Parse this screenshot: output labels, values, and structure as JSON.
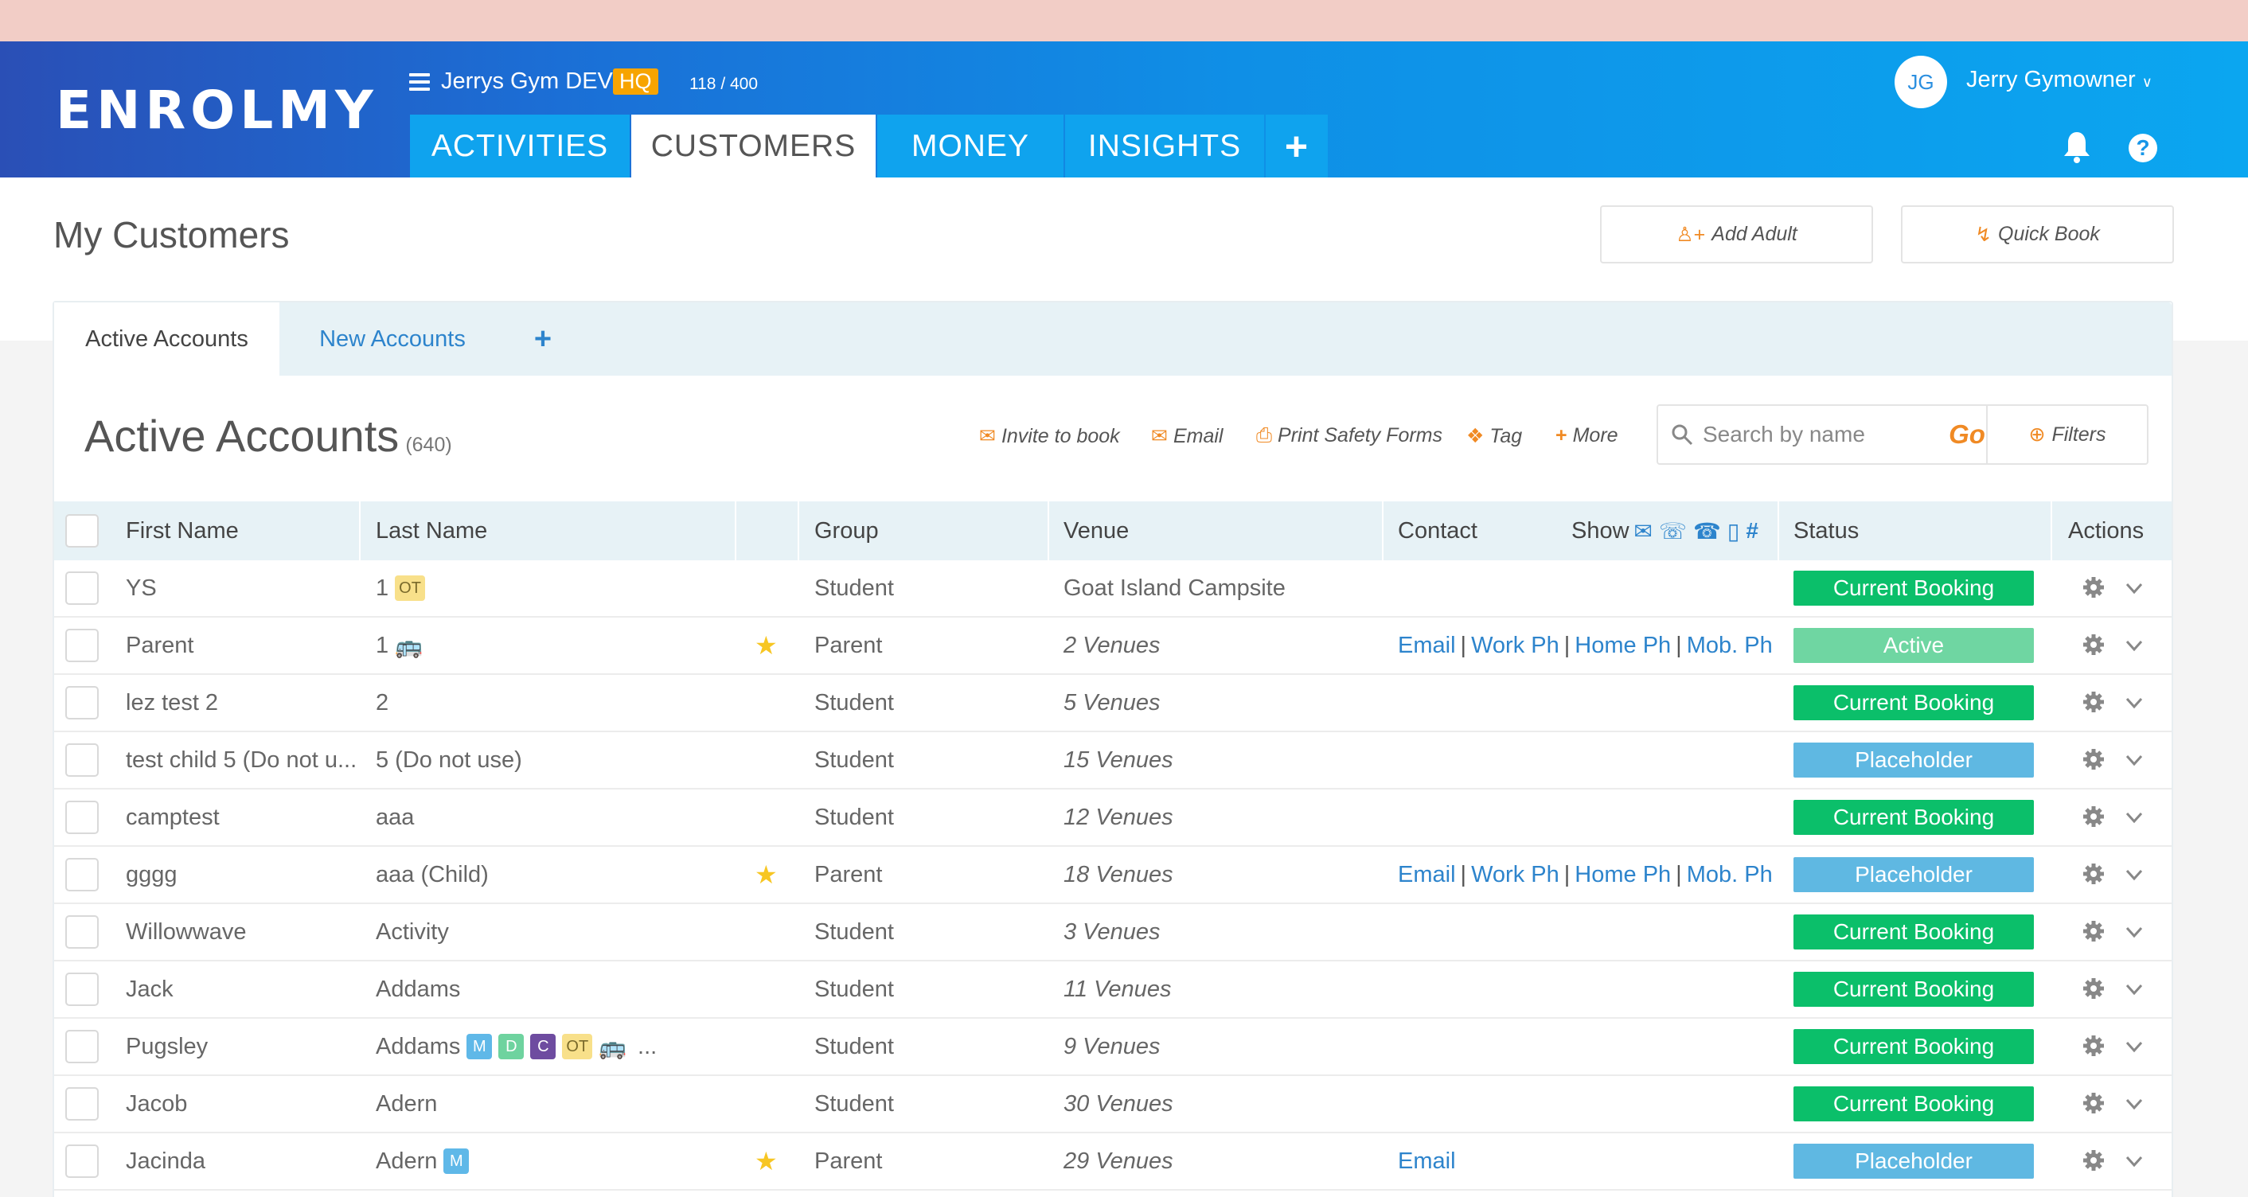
{
  "app": {
    "logo": "ENROLMY",
    "account_name": "Jerrys Gym DEV",
    "hq_badge": "HQ",
    "account_count": "118 / 400",
    "user_initials": "JG",
    "user_name": "Jerry Gymowner",
    "help_label": "?"
  },
  "nav": {
    "tabs": [
      {
        "label": "ACTIVITIES"
      },
      {
        "label": "CUSTOMERS"
      },
      {
        "label": "MONEY"
      },
      {
        "label": "INSIGHTS"
      },
      {
        "label": "+"
      }
    ]
  },
  "page": {
    "title": "My Customers",
    "add_adult_label": "Add Adult",
    "quick_book_label": "Quick Book"
  },
  "subtabs": [
    {
      "label": "Active Accounts"
    },
    {
      "label": "New Accounts"
    },
    {
      "label": "+"
    }
  ],
  "section": {
    "title": "Active Accounts",
    "count": "(640)"
  },
  "toolbar": {
    "invite": "Invite to book",
    "email": "Email",
    "print": "Print Safety Forms",
    "tag": "Tag",
    "more": "More",
    "search_placeholder": "Search by name",
    "go": "Go",
    "filters": "Filters"
  },
  "table": {
    "headers": {
      "first_name": "First Name",
      "last_name": "Last Name",
      "group": "Group",
      "venue": "Venue",
      "contact": "Contact",
      "show": "Show",
      "status": "Status",
      "actions": "Actions"
    },
    "rows": [
      {
        "first": "YS",
        "last": "1",
        "badges": [
          "OT"
        ],
        "bus": false,
        "more": "",
        "star": false,
        "group": "Student",
        "venue": "Goat Island Campsite",
        "venue_italic": false,
        "contact": [],
        "status": "Current Booking",
        "status_color": "#0bbf6a"
      },
      {
        "first": "Parent",
        "last": "1",
        "badges": [],
        "bus": true,
        "more": "",
        "star": true,
        "group": "Parent",
        "venue": "2 Venues",
        "venue_italic": true,
        "contact": [
          "Email",
          "Work Ph",
          "Home Ph",
          "Mob. Ph"
        ],
        "status": "Active",
        "status_color": "#6fd6a2"
      },
      {
        "first": "lez test 2",
        "last": "2",
        "badges": [],
        "bus": false,
        "more": "",
        "star": false,
        "group": "Student",
        "venue": "5 Venues",
        "venue_italic": true,
        "contact": [],
        "status": "Current Booking",
        "status_color": "#0bbf6a"
      },
      {
        "first": "test child 5 (Do not u...",
        "last": "5 (Do not use)",
        "badges": [],
        "bus": false,
        "more": "",
        "star": false,
        "group": "Student",
        "venue": "15 Venues",
        "venue_italic": true,
        "contact": [],
        "status": "Placeholder",
        "status_color": "#5fb8e2"
      },
      {
        "first": "camptest",
        "last": "aaa",
        "badges": [],
        "bus": false,
        "more": "",
        "star": false,
        "group": "Student",
        "venue": "12 Venues",
        "venue_italic": true,
        "contact": [],
        "status": "Current Booking",
        "status_color": "#0bbf6a"
      },
      {
        "first": "gggg",
        "last": "aaa (Child)",
        "badges": [],
        "bus": false,
        "more": "",
        "star": true,
        "group": "Parent",
        "venue": "18 Venues",
        "venue_italic": true,
        "contact": [
          "Email",
          "Work Ph",
          "Home Ph",
          "Mob. Ph"
        ],
        "status": "Placeholder",
        "status_color": "#5fb8e2"
      },
      {
        "first": "Willowwave",
        "last": "Activity",
        "badges": [],
        "bus": false,
        "more": "",
        "star": false,
        "group": "Student",
        "venue": "3 Venues",
        "venue_italic": true,
        "contact": [],
        "status": "Current Booking",
        "status_color": "#0bbf6a"
      },
      {
        "first": "Jack",
        "last": "Addams",
        "badges": [],
        "bus": false,
        "more": "",
        "star": false,
        "group": "Student",
        "venue": "11 Venues",
        "venue_italic": true,
        "contact": [],
        "status": "Current Booking",
        "status_color": "#0bbf6a"
      },
      {
        "first": "Pugsley",
        "last": "Addams",
        "badges": [
          "M",
          "D",
          "C",
          "OT"
        ],
        "bus": true,
        "more": "...",
        "star": false,
        "group": "Student",
        "venue": "9 Venues",
        "venue_italic": true,
        "contact": [],
        "status": "Current Booking",
        "status_color": "#0bbf6a"
      },
      {
        "first": "Jacob",
        "last": "Adern",
        "badges": [],
        "bus": false,
        "more": "",
        "star": false,
        "group": "Student",
        "venue": "30 Venues",
        "venue_italic": true,
        "contact": [],
        "status": "Current Booking",
        "status_color": "#0bbf6a"
      },
      {
        "first": "Jacinda",
        "last": "Adern",
        "badges": [
          "M"
        ],
        "bus": false,
        "more": "",
        "star": true,
        "group": "Parent",
        "venue": "29 Venues",
        "venue_italic": true,
        "contact": [
          "Email"
        ],
        "status": "Placeholder",
        "status_color": "#5fb8e2"
      }
    ]
  },
  "colors": {
    "accent": "#f08a24",
    "link": "#2d84cc",
    "header_start": "#2a4fb6",
    "header_end": "#0ba6f0"
  },
  "icons": {
    "menu": "hamburger-icon",
    "bell": "bell-icon",
    "help": "help-icon",
    "search": "search-icon",
    "gear": "gear-icon",
    "caret": "chevron-down-icon",
    "star": "star-icon",
    "bus": "bus-icon"
  }
}
